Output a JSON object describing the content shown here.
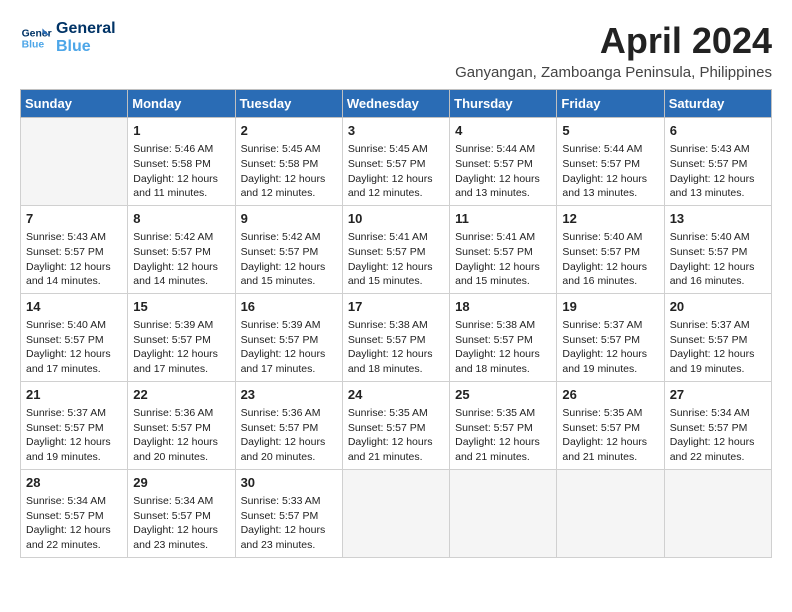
{
  "logo": {
    "line1": "General",
    "line2": "Blue"
  },
  "title": "April 2024",
  "location": "Ganyangan, Zamboanga Peninsula, Philippines",
  "days_of_week": [
    "Sunday",
    "Monday",
    "Tuesday",
    "Wednesday",
    "Thursday",
    "Friday",
    "Saturday"
  ],
  "weeks": [
    [
      {
        "day": "",
        "info": ""
      },
      {
        "day": "1",
        "info": "Sunrise: 5:46 AM\nSunset: 5:58 PM\nDaylight: 12 hours\nand 11 minutes."
      },
      {
        "day": "2",
        "info": "Sunrise: 5:45 AM\nSunset: 5:58 PM\nDaylight: 12 hours\nand 12 minutes."
      },
      {
        "day": "3",
        "info": "Sunrise: 5:45 AM\nSunset: 5:57 PM\nDaylight: 12 hours\nand 12 minutes."
      },
      {
        "day": "4",
        "info": "Sunrise: 5:44 AM\nSunset: 5:57 PM\nDaylight: 12 hours\nand 13 minutes."
      },
      {
        "day": "5",
        "info": "Sunrise: 5:44 AM\nSunset: 5:57 PM\nDaylight: 12 hours\nand 13 minutes."
      },
      {
        "day": "6",
        "info": "Sunrise: 5:43 AM\nSunset: 5:57 PM\nDaylight: 12 hours\nand 13 minutes."
      }
    ],
    [
      {
        "day": "7",
        "info": "Sunrise: 5:43 AM\nSunset: 5:57 PM\nDaylight: 12 hours\nand 14 minutes."
      },
      {
        "day": "8",
        "info": "Sunrise: 5:42 AM\nSunset: 5:57 PM\nDaylight: 12 hours\nand 14 minutes."
      },
      {
        "day": "9",
        "info": "Sunrise: 5:42 AM\nSunset: 5:57 PM\nDaylight: 12 hours\nand 15 minutes."
      },
      {
        "day": "10",
        "info": "Sunrise: 5:41 AM\nSunset: 5:57 PM\nDaylight: 12 hours\nand 15 minutes."
      },
      {
        "day": "11",
        "info": "Sunrise: 5:41 AM\nSunset: 5:57 PM\nDaylight: 12 hours\nand 15 minutes."
      },
      {
        "day": "12",
        "info": "Sunrise: 5:40 AM\nSunset: 5:57 PM\nDaylight: 12 hours\nand 16 minutes."
      },
      {
        "day": "13",
        "info": "Sunrise: 5:40 AM\nSunset: 5:57 PM\nDaylight: 12 hours\nand 16 minutes."
      }
    ],
    [
      {
        "day": "14",
        "info": "Sunrise: 5:40 AM\nSunset: 5:57 PM\nDaylight: 12 hours\nand 17 minutes."
      },
      {
        "day": "15",
        "info": "Sunrise: 5:39 AM\nSunset: 5:57 PM\nDaylight: 12 hours\nand 17 minutes."
      },
      {
        "day": "16",
        "info": "Sunrise: 5:39 AM\nSunset: 5:57 PM\nDaylight: 12 hours\nand 17 minutes."
      },
      {
        "day": "17",
        "info": "Sunrise: 5:38 AM\nSunset: 5:57 PM\nDaylight: 12 hours\nand 18 minutes."
      },
      {
        "day": "18",
        "info": "Sunrise: 5:38 AM\nSunset: 5:57 PM\nDaylight: 12 hours\nand 18 minutes."
      },
      {
        "day": "19",
        "info": "Sunrise: 5:37 AM\nSunset: 5:57 PM\nDaylight: 12 hours\nand 19 minutes."
      },
      {
        "day": "20",
        "info": "Sunrise: 5:37 AM\nSunset: 5:57 PM\nDaylight: 12 hours\nand 19 minutes."
      }
    ],
    [
      {
        "day": "21",
        "info": "Sunrise: 5:37 AM\nSunset: 5:57 PM\nDaylight: 12 hours\nand 19 minutes."
      },
      {
        "day": "22",
        "info": "Sunrise: 5:36 AM\nSunset: 5:57 PM\nDaylight: 12 hours\nand 20 minutes."
      },
      {
        "day": "23",
        "info": "Sunrise: 5:36 AM\nSunset: 5:57 PM\nDaylight: 12 hours\nand 20 minutes."
      },
      {
        "day": "24",
        "info": "Sunrise: 5:35 AM\nSunset: 5:57 PM\nDaylight: 12 hours\nand 21 minutes."
      },
      {
        "day": "25",
        "info": "Sunrise: 5:35 AM\nSunset: 5:57 PM\nDaylight: 12 hours\nand 21 minutes."
      },
      {
        "day": "26",
        "info": "Sunrise: 5:35 AM\nSunset: 5:57 PM\nDaylight: 12 hours\nand 21 minutes."
      },
      {
        "day": "27",
        "info": "Sunrise: 5:34 AM\nSunset: 5:57 PM\nDaylight: 12 hours\nand 22 minutes."
      }
    ],
    [
      {
        "day": "28",
        "info": "Sunrise: 5:34 AM\nSunset: 5:57 PM\nDaylight: 12 hours\nand 22 minutes."
      },
      {
        "day": "29",
        "info": "Sunrise: 5:34 AM\nSunset: 5:57 PM\nDaylight: 12 hours\nand 23 minutes."
      },
      {
        "day": "30",
        "info": "Sunrise: 5:33 AM\nSunset: 5:57 PM\nDaylight: 12 hours\nand 23 minutes."
      },
      {
        "day": "",
        "info": ""
      },
      {
        "day": "",
        "info": ""
      },
      {
        "day": "",
        "info": ""
      },
      {
        "day": "",
        "info": ""
      }
    ]
  ]
}
